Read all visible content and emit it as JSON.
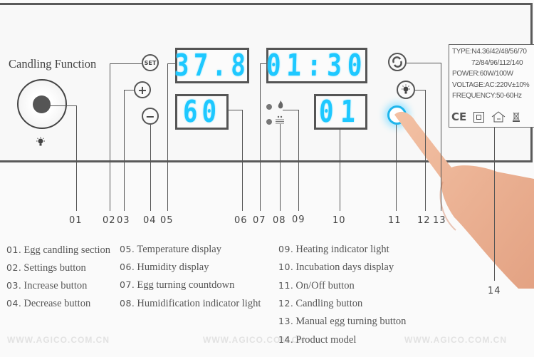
{
  "panel": {
    "candling_title": "Candling Function",
    "buttons": {
      "set_label": "SET",
      "plus_label": "+",
      "minus_label": "−"
    },
    "displays": {
      "temperature": "37.8",
      "timer": "01:30",
      "humidity": "60",
      "days": "01"
    },
    "icons": {
      "candle_bulb": "lightbulb-icon",
      "heating": "flame-icon",
      "humidification": "water-drops-icon",
      "manual_turn": "rotate-icon",
      "candling": "lightbulb-icon",
      "power": "power-ring-icon"
    },
    "spec": {
      "type_line1": "TYPE:N4.36/42/48/56/70",
      "type_line2": "72/84/96/112/140",
      "power": "POWER:60W/100W",
      "voltage": "VOLTAGE:AC:220V±10%",
      "frequency": "FREQUENCY:50-60Hz",
      "marks": [
        "CE",
        "□",
        "⌂",
        "⌧"
      ]
    }
  },
  "callouts": [
    "01",
    "02",
    "03",
    "04",
    "05",
    "06",
    "07",
    "08",
    "09",
    "10",
    "11",
    "12",
    "13",
    "14"
  ],
  "legend": [
    {
      "num": "01.",
      "text": "Egg candling section"
    },
    {
      "num": "02.",
      "text": "Settings button"
    },
    {
      "num": "03.",
      "text": "Increase button"
    },
    {
      "num": "04.",
      "text": "Decrease button"
    },
    {
      "num": "05.",
      "text": "Temperature display"
    },
    {
      "num": "06.",
      "text": "Humidity display"
    },
    {
      "num": "07.",
      "text": "Egg turning countdown"
    },
    {
      "num": "08.",
      "text": "Humidification indicator light"
    },
    {
      "num": "09.",
      "text": "Heating indicator light"
    },
    {
      "num": "10.",
      "text": "Incubation days display"
    },
    {
      "num": "11.",
      "text": "On/Off button"
    },
    {
      "num": "12.",
      "text": "Candling button"
    },
    {
      "num": "13.",
      "text": "Manual egg turning button"
    },
    {
      "num": "14.",
      "text": "Product model"
    }
  ],
  "watermark": "WWW.AGICO.COM.CN"
}
